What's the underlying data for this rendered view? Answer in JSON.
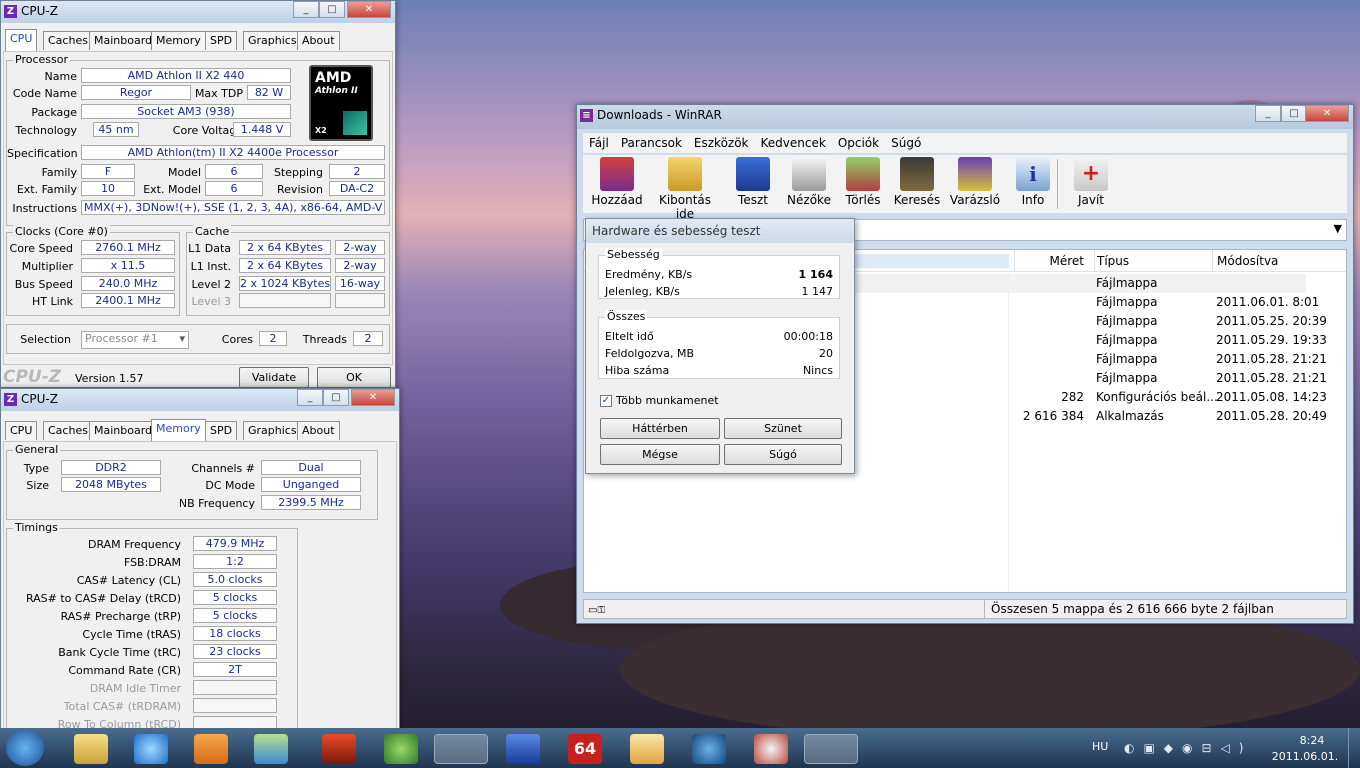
{
  "cpuz1": {
    "title": "CPU-Z",
    "tabs": [
      "CPU",
      "Caches",
      "Mainboard",
      "Memory",
      "SPD",
      "Graphics",
      "About"
    ],
    "processor": {
      "group": "Processor",
      "name_label": "Name",
      "name": "AMD Athlon II X2 440",
      "codename_label": "Code Name",
      "codename": "Regor",
      "maxtdp_label": "Max TDP",
      "maxtdp": "82 W",
      "package_label": "Package",
      "package": "Socket AM3 (938)",
      "technology_label": "Technology",
      "technology": "45 nm",
      "corevoltage_label": "Core Voltage",
      "corevoltage": "1.448 V",
      "spec_label": "Specification",
      "spec": "AMD Athlon(tm) II X2 4400e Processor",
      "family_label": "Family",
      "family": "F",
      "model_label": "Model",
      "model": "6",
      "stepping_label": "Stepping",
      "stepping": "2",
      "extfamily_label": "Ext. Family",
      "extfamily": "10",
      "extmodel_label": "Ext. Model",
      "extmodel": "6",
      "revision_label": "Revision",
      "revision": "DA-C2",
      "instructions_label": "Instructions",
      "instructions": "MMX(+), 3DNow!(+), SSE (1, 2, 3, 4A), x86-64, AMD-V",
      "logo_brand": "AMD",
      "logo_line": "Athlon II",
      "logo_x2": "X2"
    },
    "clocks": {
      "group": "Clocks (Core #0)",
      "corespeed_label": "Core Speed",
      "corespeed": "2760.1 MHz",
      "multiplier_label": "Multiplier",
      "multiplier": "x 11.5",
      "busspeed_label": "Bus Speed",
      "busspeed": "240.0 MHz",
      "htlink_label": "HT Link",
      "htlink": "2400.1 MHz"
    },
    "cache": {
      "group": "Cache",
      "l1data_label": "L1 Data",
      "l1data": "2 x 64 KBytes",
      "l1data_way": "2-way",
      "l1inst_label": "L1 Inst.",
      "l1inst": "2 x 64 KBytes",
      "l1inst_way": "2-way",
      "level2_label": "Level 2",
      "level2": "2 x 1024 KBytes",
      "level2_way": "16-way",
      "level3_label": "Level 3"
    },
    "selection_label": "Selection",
    "selection": "Processor #1",
    "cores_label": "Cores",
    "cores": "2",
    "threads_label": "Threads",
    "threads": "2",
    "brand": "CPU-Z",
    "version": "Version 1.57",
    "validate": "Validate",
    "ok": "OK"
  },
  "cpuz2": {
    "title": "CPU-Z",
    "tabs": [
      "CPU",
      "Caches",
      "Mainboard",
      "Memory",
      "SPD",
      "Graphics",
      "About"
    ],
    "general": {
      "group": "General",
      "type_label": "Type",
      "type": "DDR2",
      "size_label": "Size",
      "size": "2048 MBytes",
      "channels_label": "Channels #",
      "channels": "Dual",
      "dcmode_label": "DC Mode",
      "dcmode": "Unganged",
      "nbfreq_label": "NB Frequency",
      "nbfreq": "2399.5 MHz"
    },
    "timings": {
      "group": "Timings",
      "rows": [
        {
          "label": "DRAM Frequency",
          "value": "479.9 MHz"
        },
        {
          "label": "FSB:DRAM",
          "value": "1:2"
        },
        {
          "label": "CAS# Latency (CL)",
          "value": "5.0 clocks"
        },
        {
          "label": "RAS# to CAS# Delay (tRCD)",
          "value": "5 clocks"
        },
        {
          "label": "RAS# Precharge (tRP)",
          "value": "5 clocks"
        },
        {
          "label": "Cycle Time (tRAS)",
          "value": "18 clocks"
        },
        {
          "label": "Bank Cycle Time (tRC)",
          "value": "23 clocks"
        },
        {
          "label": "Command Rate (CR)",
          "value": "2T"
        },
        {
          "label": "DRAM Idle Timer",
          "value": ""
        },
        {
          "label": "Total CAS# (tRDRAM)",
          "value": ""
        },
        {
          "label": "Row To Column (tRCD)",
          "value": ""
        }
      ]
    }
  },
  "winrar": {
    "title": "Downloads - WinRAR",
    "menu": [
      "Fájl",
      "Parancsok",
      "Eszközök",
      "Kedvencek",
      "Opciók",
      "Súgó"
    ],
    "tools": [
      "Hozzáad",
      "Kibontás ide",
      "Teszt",
      "Nézőke",
      "Törlés",
      "Keresés",
      "Varázsló",
      "Info",
      "Javít"
    ],
    "columns": {
      "size": "Méret",
      "type": "Típus",
      "modified": "Módosítva"
    },
    "rows": [
      {
        "size": "",
        "type": "Fájlmappa",
        "date": ""
      },
      {
        "size": "",
        "type": "Fájlmappa",
        "date": "2011.06.01. 8:01"
      },
      {
        "size": "",
        "type": "Fájlmappa",
        "date": "2011.05.25. 20:39"
      },
      {
        "size": "",
        "type": "Fájlmappa",
        "date": "2011.05.29. 19:33"
      },
      {
        "size": "",
        "type": "Fájlmappa",
        "date": "2011.05.28. 21:21"
      },
      {
        "size": "",
        "type": "Fájlmappa",
        "date": "2011.05.28. 21:21"
      },
      {
        "size": "282",
        "type": "Konfigurációs beál...",
        "date": "2011.05.08. 14:23"
      },
      {
        "size": "2 616 384",
        "type": "Alkalmazás",
        "date": "2011.05.28. 20:49"
      }
    ],
    "status": "Összesen 5 mappa és 2 616 666 byte 2 fájlban"
  },
  "dialog": {
    "title": "Hardware és sebesség teszt",
    "speed_group": "Sebesség",
    "result_label": "Eredmény, KB/s",
    "result": "1 164",
    "current_label": "Jelenleg, KB/s",
    "current": "1 147",
    "total_group": "Összes",
    "elapsed_label": "Eltelt idő",
    "elapsed": "00:00:18",
    "processed_label": "Feldolgozva, MB",
    "processed": "20",
    "errors_label": "Hiba száma",
    "errors": "Nincs",
    "multithread_label": "Több munkamenet",
    "btn_background": "Háttérben",
    "btn_pause": "Szünet",
    "btn_cancel": "Mégse",
    "btn_help": "Súgó"
  },
  "taskbar": {
    "lang": "HU",
    "time": "8:24",
    "date": "2011.06.01.",
    "icons": [
      "explorer",
      "internet-explorer",
      "media-player",
      "messenger",
      "app-x",
      "utorrent",
      "winrar",
      "save",
      "64bit-app",
      "mail",
      "google-earth",
      "chrome-like",
      "cpuz"
    ]
  }
}
